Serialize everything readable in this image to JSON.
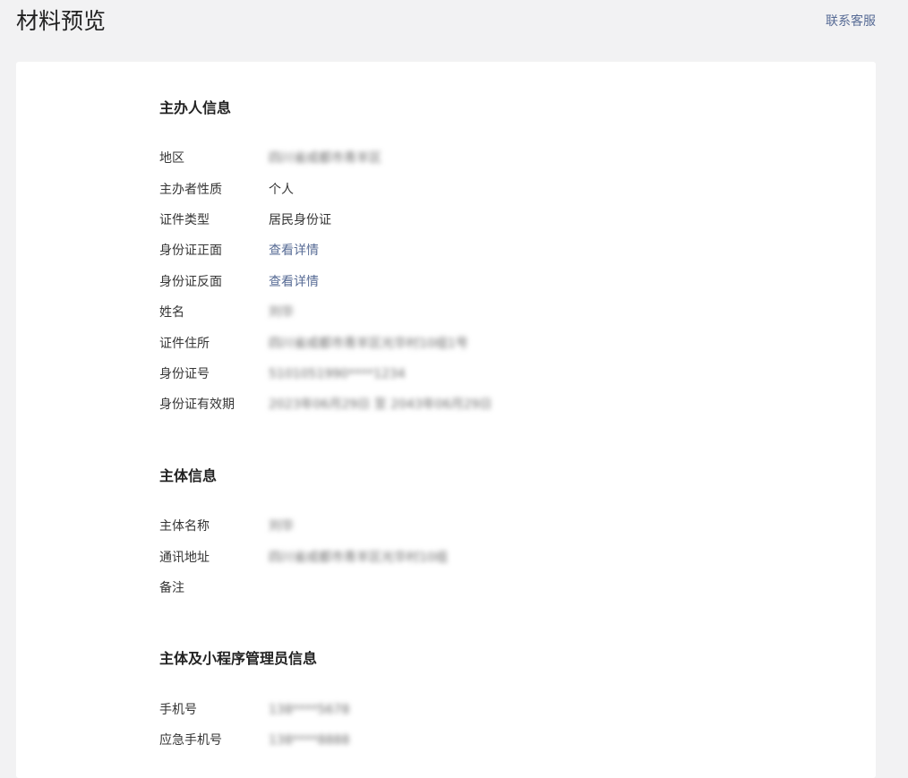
{
  "header": {
    "title": "材料预览",
    "contact": "联系客服"
  },
  "sponsor": {
    "title": "主办人信息",
    "rows": [
      {
        "label": "地区",
        "value": "四川省成都市青羊区"
      },
      {
        "label": "主办者性质",
        "value": "个人"
      },
      {
        "label": "证件类型",
        "value": "居民身份证"
      },
      {
        "label": "身份证正面",
        "value": "查看详情"
      },
      {
        "label": "身份证反面",
        "value": "查看详情"
      },
      {
        "label": "姓名",
        "value": "刘华"
      },
      {
        "label": "证件住所",
        "value": "四川省成都市青羊区光华村10组1号"
      },
      {
        "label": "身份证号",
        "value": "5101051990****1234"
      },
      {
        "label": "身份证有效期",
        "value": "2023年06月29日 至 2043年06月29日"
      }
    ]
  },
  "entity": {
    "title": "主体信息",
    "rows": [
      {
        "label": "主体名称",
        "value": "刘华"
      },
      {
        "label": "通讯地址",
        "value": "四川省成都市青羊区光华村10组"
      },
      {
        "label": "备注",
        "value": ""
      }
    ]
  },
  "admin": {
    "title": "主体及小程序管理员信息",
    "rows": [
      {
        "label": "手机号",
        "value": "138****5678"
      },
      {
        "label": "应急手机号",
        "value": "138****8888"
      }
    ]
  }
}
